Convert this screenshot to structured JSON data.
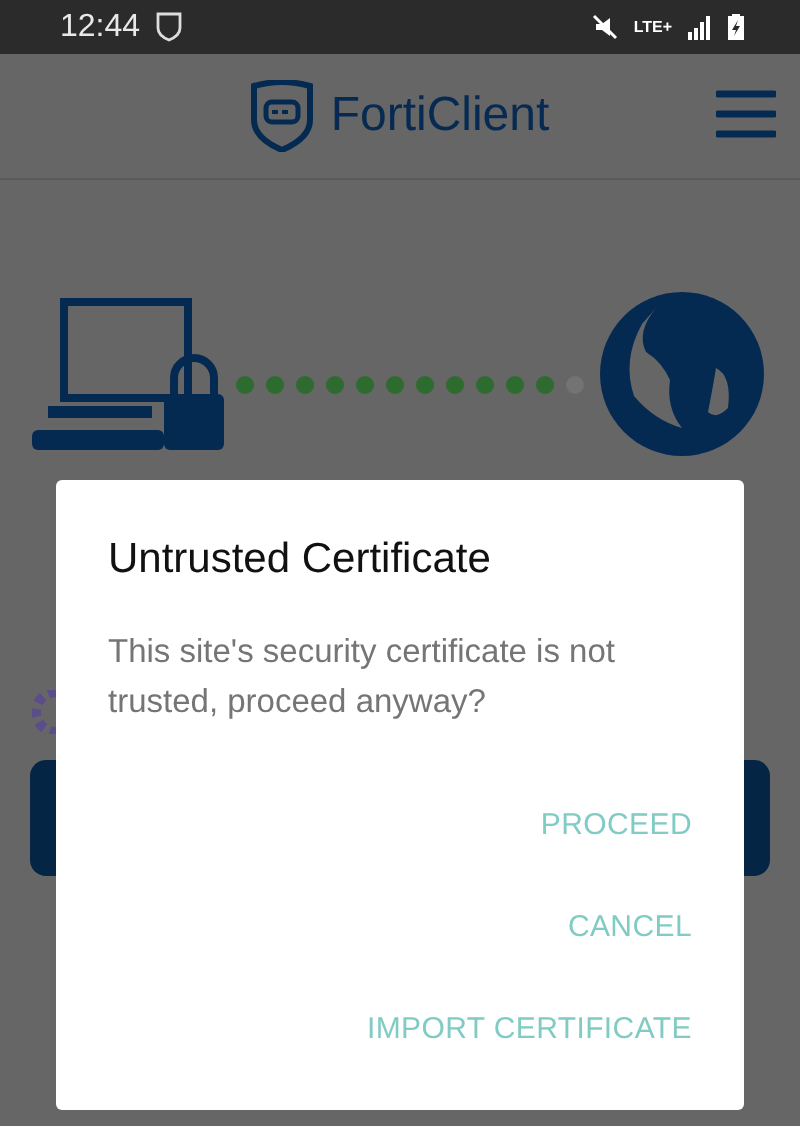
{
  "status_bar": {
    "time": "12:44",
    "network": "LTE+"
  },
  "header": {
    "logo_text": "FortiClient"
  },
  "dialog": {
    "title": "Untrusted Certificate",
    "message": "This site's security certificate is not trusted, proceed anyway?",
    "actions": [
      "PROCEED",
      "CANCEL",
      "IMPORT CERTIFICATE"
    ]
  }
}
